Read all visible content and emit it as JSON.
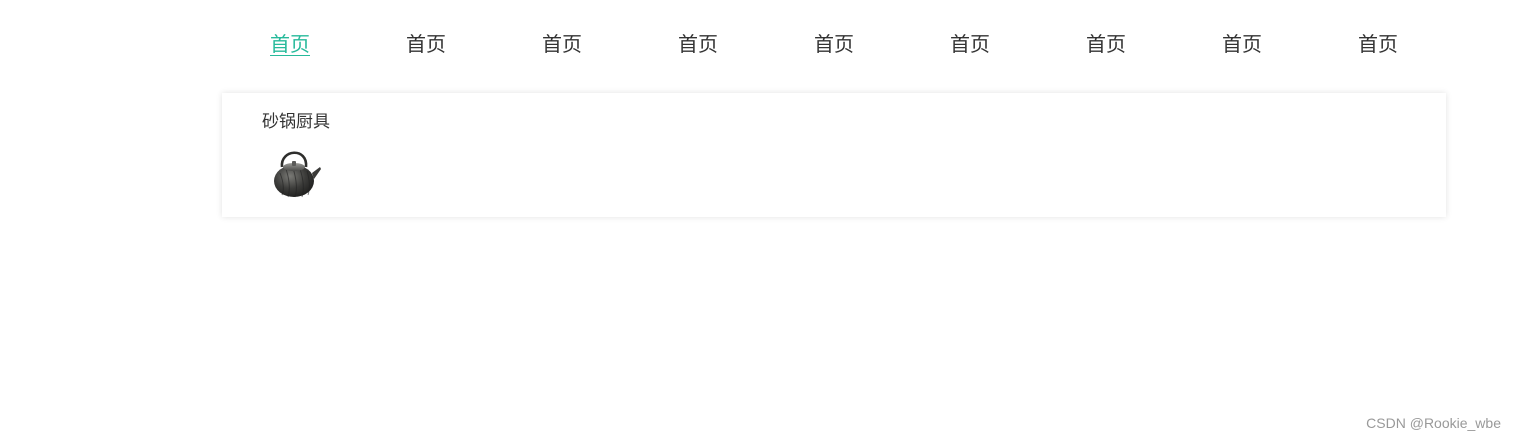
{
  "nav": {
    "items": [
      {
        "label": "首页",
        "active": true
      },
      {
        "label": "首页",
        "active": false
      },
      {
        "label": "首页",
        "active": false
      },
      {
        "label": "首页",
        "active": false
      },
      {
        "label": "首页",
        "active": false
      },
      {
        "label": "首页",
        "active": false
      },
      {
        "label": "首页",
        "active": false
      },
      {
        "label": "首页",
        "active": false
      },
      {
        "label": "首页",
        "active": false
      }
    ],
    "active_color": "#27ba9b",
    "text_color": "#333333"
  },
  "panel": {
    "category": {
      "label": "砂锅厨具",
      "icon": "teapot-icon"
    }
  },
  "watermark": "CSDN @Rookie_wbe"
}
